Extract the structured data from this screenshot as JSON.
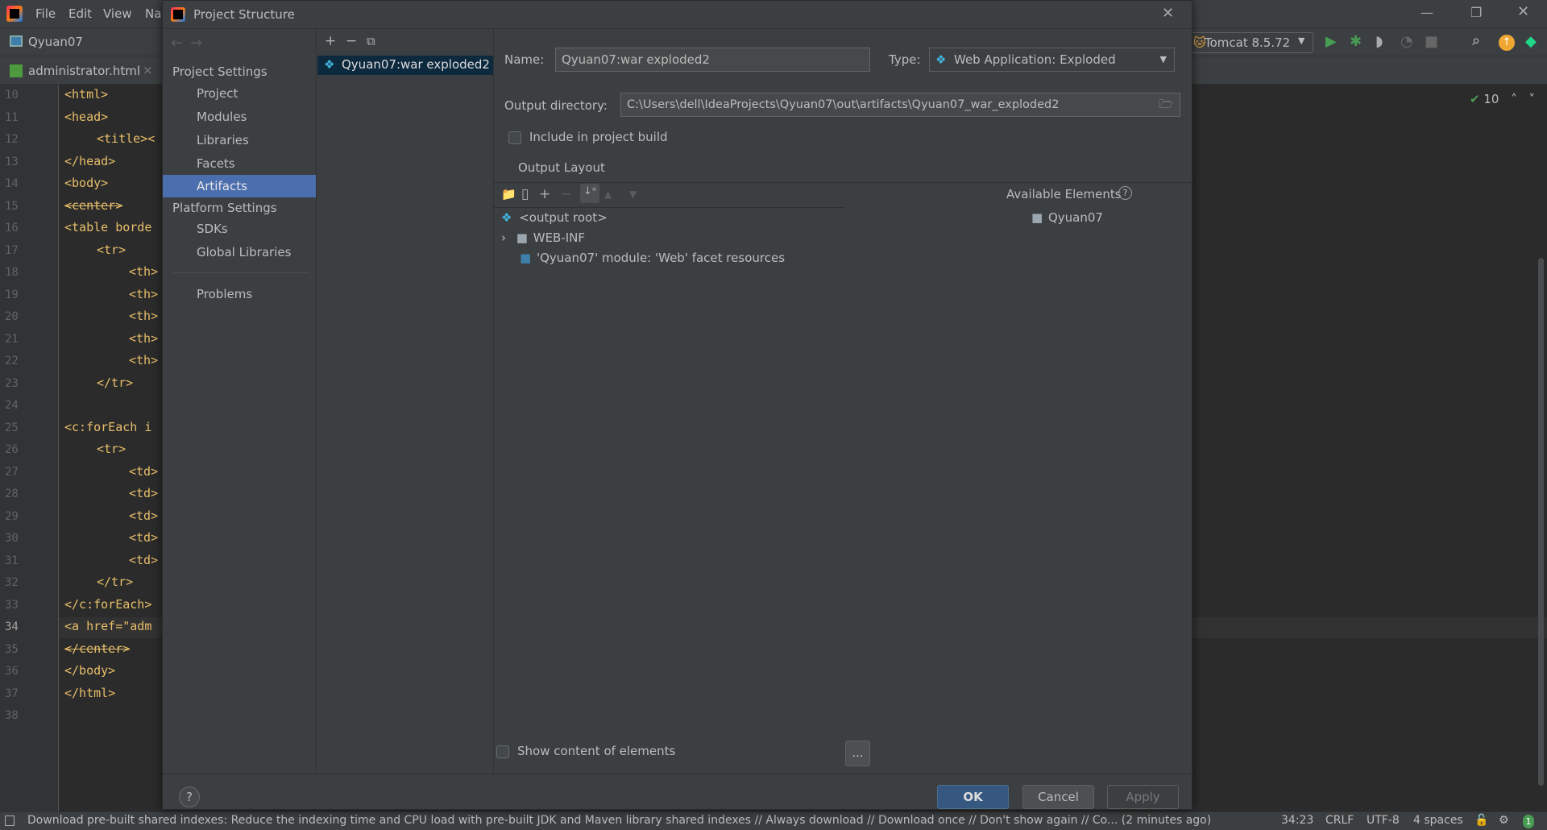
{
  "ide": {
    "menu": [
      "File",
      "Edit",
      "View",
      "Na"
    ],
    "project_name": "Qyuan07",
    "run_config": "Tomcat 8.5.72",
    "file_tab": "administrator.html",
    "inspection_count": "10",
    "code_lines": [
      {
        "n": "10",
        "indent": 0,
        "text": "<html>"
      },
      {
        "n": "11",
        "indent": 0,
        "text": "<head>"
      },
      {
        "n": "12",
        "indent": 1,
        "text": "<title><"
      },
      {
        "n": "13",
        "indent": 0,
        "text": "</head>"
      },
      {
        "n": "14",
        "indent": 0,
        "text": "<body>"
      },
      {
        "n": "15",
        "indent": 0,
        "text": "<center>"
      },
      {
        "n": "16",
        "indent": 0,
        "text": "<table borde"
      },
      {
        "n": "17",
        "indent": 1,
        "text": "<tr>"
      },
      {
        "n": "18",
        "indent": 2,
        "text": "<th>"
      },
      {
        "n": "19",
        "indent": 2,
        "text": "<th>"
      },
      {
        "n": "20",
        "indent": 2,
        "text": "<th>"
      },
      {
        "n": "21",
        "indent": 2,
        "text": "<th>"
      },
      {
        "n": "22",
        "indent": 2,
        "text": "<th>"
      },
      {
        "n": "23",
        "indent": 1,
        "text": "</tr>"
      },
      {
        "n": "24",
        "indent": 0,
        "text": ""
      },
      {
        "n": "25",
        "indent": 0,
        "text": "<c:forEach i"
      },
      {
        "n": "26",
        "indent": 1,
        "text": "<tr>"
      },
      {
        "n": "27",
        "indent": 2,
        "text": "<td>"
      },
      {
        "n": "28",
        "indent": 2,
        "text": "<td>"
      },
      {
        "n": "29",
        "indent": 2,
        "text": "<td>"
      },
      {
        "n": "30",
        "indent": 2,
        "text": "<td>"
      },
      {
        "n": "31",
        "indent": 2,
        "text": "<td>"
      },
      {
        "n": "32",
        "indent": 1,
        "text": "</tr>"
      },
      {
        "n": "33",
        "indent": 0,
        "text": "</c:forEach>"
      },
      {
        "n": "34",
        "indent": 0,
        "text": "<a href=\"adm"
      },
      {
        "n": "35",
        "indent": 0,
        "text": "</center>"
      },
      {
        "n": "36",
        "indent": 0,
        "text": "</body>"
      },
      {
        "n": "37",
        "indent": 0,
        "text": "</html>"
      },
      {
        "n": "38",
        "indent": 0,
        "text": ""
      }
    ],
    "status": {
      "message": "Download pre-built shared indexes: Reduce the indexing time and CPU load with pre-built JDK and Maven library shared indexes // Always download // Download once // Don't show again // Co... (2 minutes ago)",
      "position": "34:23",
      "line_sep": "CRLF",
      "encoding": "UTF-8",
      "indent": "4 spaces",
      "notifications": "1"
    }
  },
  "dialog": {
    "title": "Project Structure",
    "nav": {
      "project_settings": "Project Settings",
      "items": [
        "Project",
        "Modules",
        "Libraries",
        "Facets",
        "Artifacts"
      ],
      "platform_settings": "Platform Settings",
      "platform_items": [
        "SDKs",
        "Global Libraries"
      ],
      "problems": "Problems",
      "selected": "Artifacts"
    },
    "artifacts": [
      "Qyuan07:war exploded2"
    ],
    "name_label": "Name:",
    "name_value": "Qyuan07:war exploded2",
    "type_label": "Type:",
    "type_value": "Web Application: Exploded",
    "output_dir_label": "Output directory:",
    "output_dir_value": "C:\\Users\\dell\\IdeaProjects\\Qyuan07\\out\\artifacts\\Qyuan07_war_exploded2",
    "include_build": "Include in project build",
    "include_build_checked": false,
    "output_layout": "Output Layout",
    "available_elements": "Available Elements",
    "tree": [
      "<output root>",
      "WEB-INF",
      "'Qyuan07' module: 'Web' facet resources"
    ],
    "available": [
      "Qyuan07"
    ],
    "show_content": "Show content of elements",
    "show_content_checked": false,
    "more": "...",
    "ok": "OK",
    "cancel": "Cancel",
    "apply": "Apply",
    "help": "?"
  },
  "colors": {
    "selection": "#4b6eaf",
    "ok": "#365880",
    "run": "#499c54",
    "tag": "#e8bf6a"
  }
}
